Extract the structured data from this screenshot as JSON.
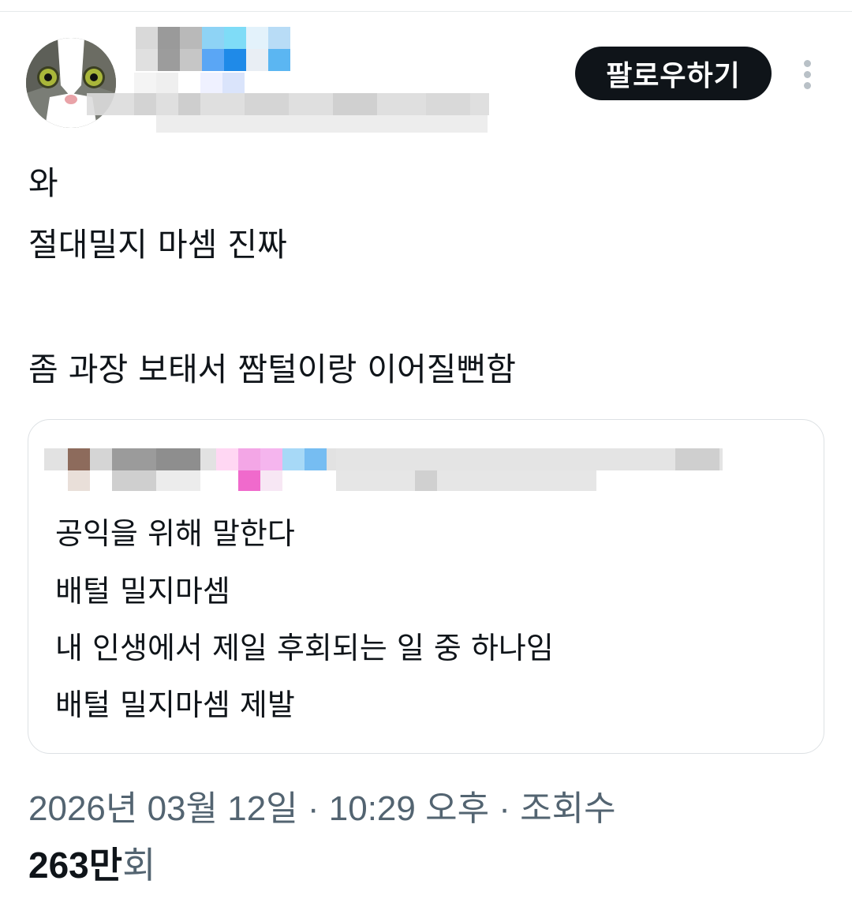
{
  "header": {
    "follow_label": "팔로우하기"
  },
  "tweet": {
    "lines": [
      "와",
      "절대밀지 마셈 진짜",
      "좀 과장 보태서 짬털이랑 이어질뻔함"
    ]
  },
  "quoted_tweet": {
    "lines": [
      "공익을 위해 말한다",
      "배털 밀지마셈",
      "내 인생에서 제일 후회되는 일 중 하나임",
      "배털 밀지마셈 제발"
    ]
  },
  "meta": {
    "datetime": "2026년 03월 12일 · 10:29 오후 · 조회수",
    "views_number": "263",
    "views_unit": "만",
    "views_suffix": "회"
  },
  "colors": {
    "follow_button_bg": "#0f1419",
    "meta_text": "#536471",
    "border": "#dde1e4"
  },
  "icons": {
    "more": "vertical-ellipsis",
    "avatar": "cat-photo"
  }
}
